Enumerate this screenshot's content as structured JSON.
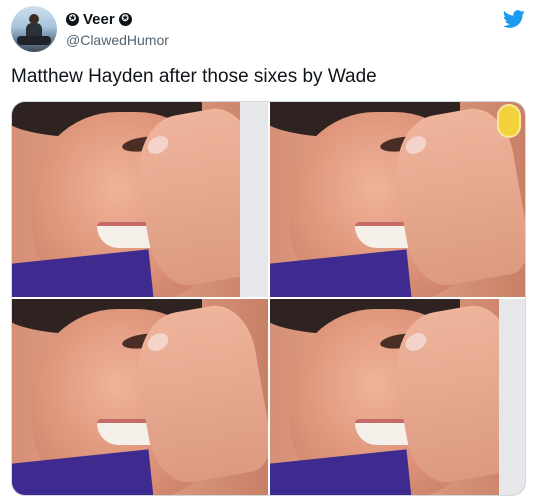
{
  "tweet": {
    "display_name": "Veer",
    "handle": "@ClawedHumor",
    "text": "Matthew Hayden after those sixes by Wade",
    "verified_icon": "star-badge-icon",
    "platform_icon": "twitter-bird-icon",
    "brand_color": "#1d9bf0"
  },
  "media": {
    "layout": "2x2 grid",
    "panels": [
      "panel-top-left",
      "panel-top-right",
      "panel-bottom-left",
      "panel-bottom-right"
    ]
  }
}
